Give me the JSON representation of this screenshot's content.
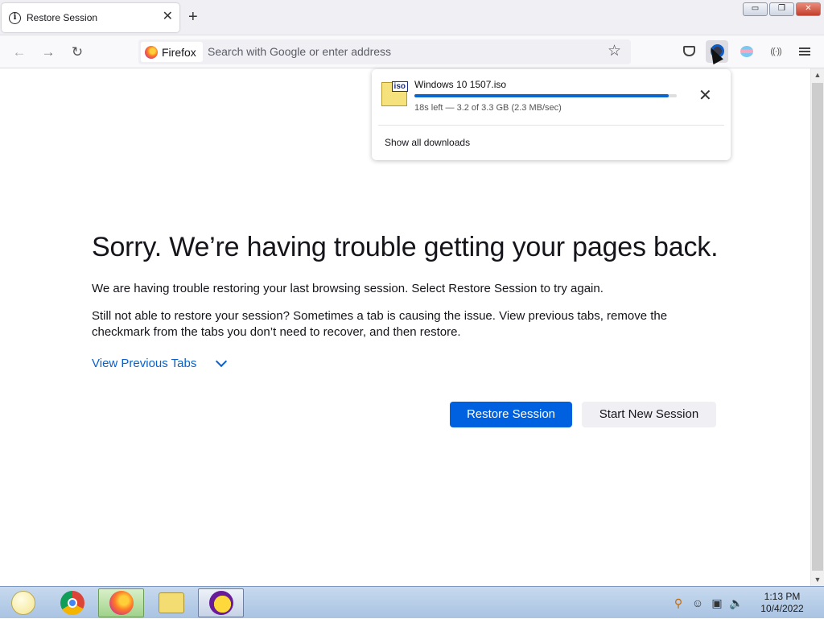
{
  "window": {
    "tab_title": "Restore Session",
    "tab_close": "✕",
    "new_tab": "+",
    "minimize": "▭",
    "restore": "❐",
    "close": "✕"
  },
  "navbar": {
    "back": "←",
    "forward": "→",
    "reload": "↻",
    "identity_label": "Firefox",
    "url_placeholder": "Search with Google or enter address",
    "bookmark_star": "☆"
  },
  "toolbar_icons": [
    "pocket-icon",
    "downloads-icon",
    "extension-icon",
    "extension-2-icon",
    "menu-icon"
  ],
  "downloads_panel": {
    "icon_label": "iso",
    "file_name": "Windows 10 1507.iso",
    "progress_fraction": 0.97,
    "status": "18s left — 3.2 of 3.3 GB (2.3 MB/sec)",
    "cancel": "✕",
    "show_all": "Show all downloads"
  },
  "content": {
    "title": "Sorry. We’re having trouble getting your pages back.",
    "paragraph1": "We are having trouble restoring your last browsing session. Select Restore Session to try again.",
    "paragraph2": "Still not able to restore your session? Sometimes a tab is causing the issue. View previous tabs, remove the checkmark from the tabs you don’t need to recover, and then restore.",
    "view_previous_tabs": "View Previous Tabs",
    "restore_button": "Restore Session",
    "new_session_button": "Start New Session"
  },
  "scrollbar": {
    "up": "▲",
    "down": "▼"
  },
  "taskbar": {
    "apps": [
      "smiley-app-icon",
      "chrome-icon",
      "firefox-icon",
      "folder-people-icon",
      "yahoo-messenger-icon"
    ],
    "time": "1:13 PM",
    "date": "10/4/2022"
  },
  "colors": {
    "primary_button": "#0061e0",
    "link": "#0a61c9",
    "progress": "#0a66cc"
  }
}
